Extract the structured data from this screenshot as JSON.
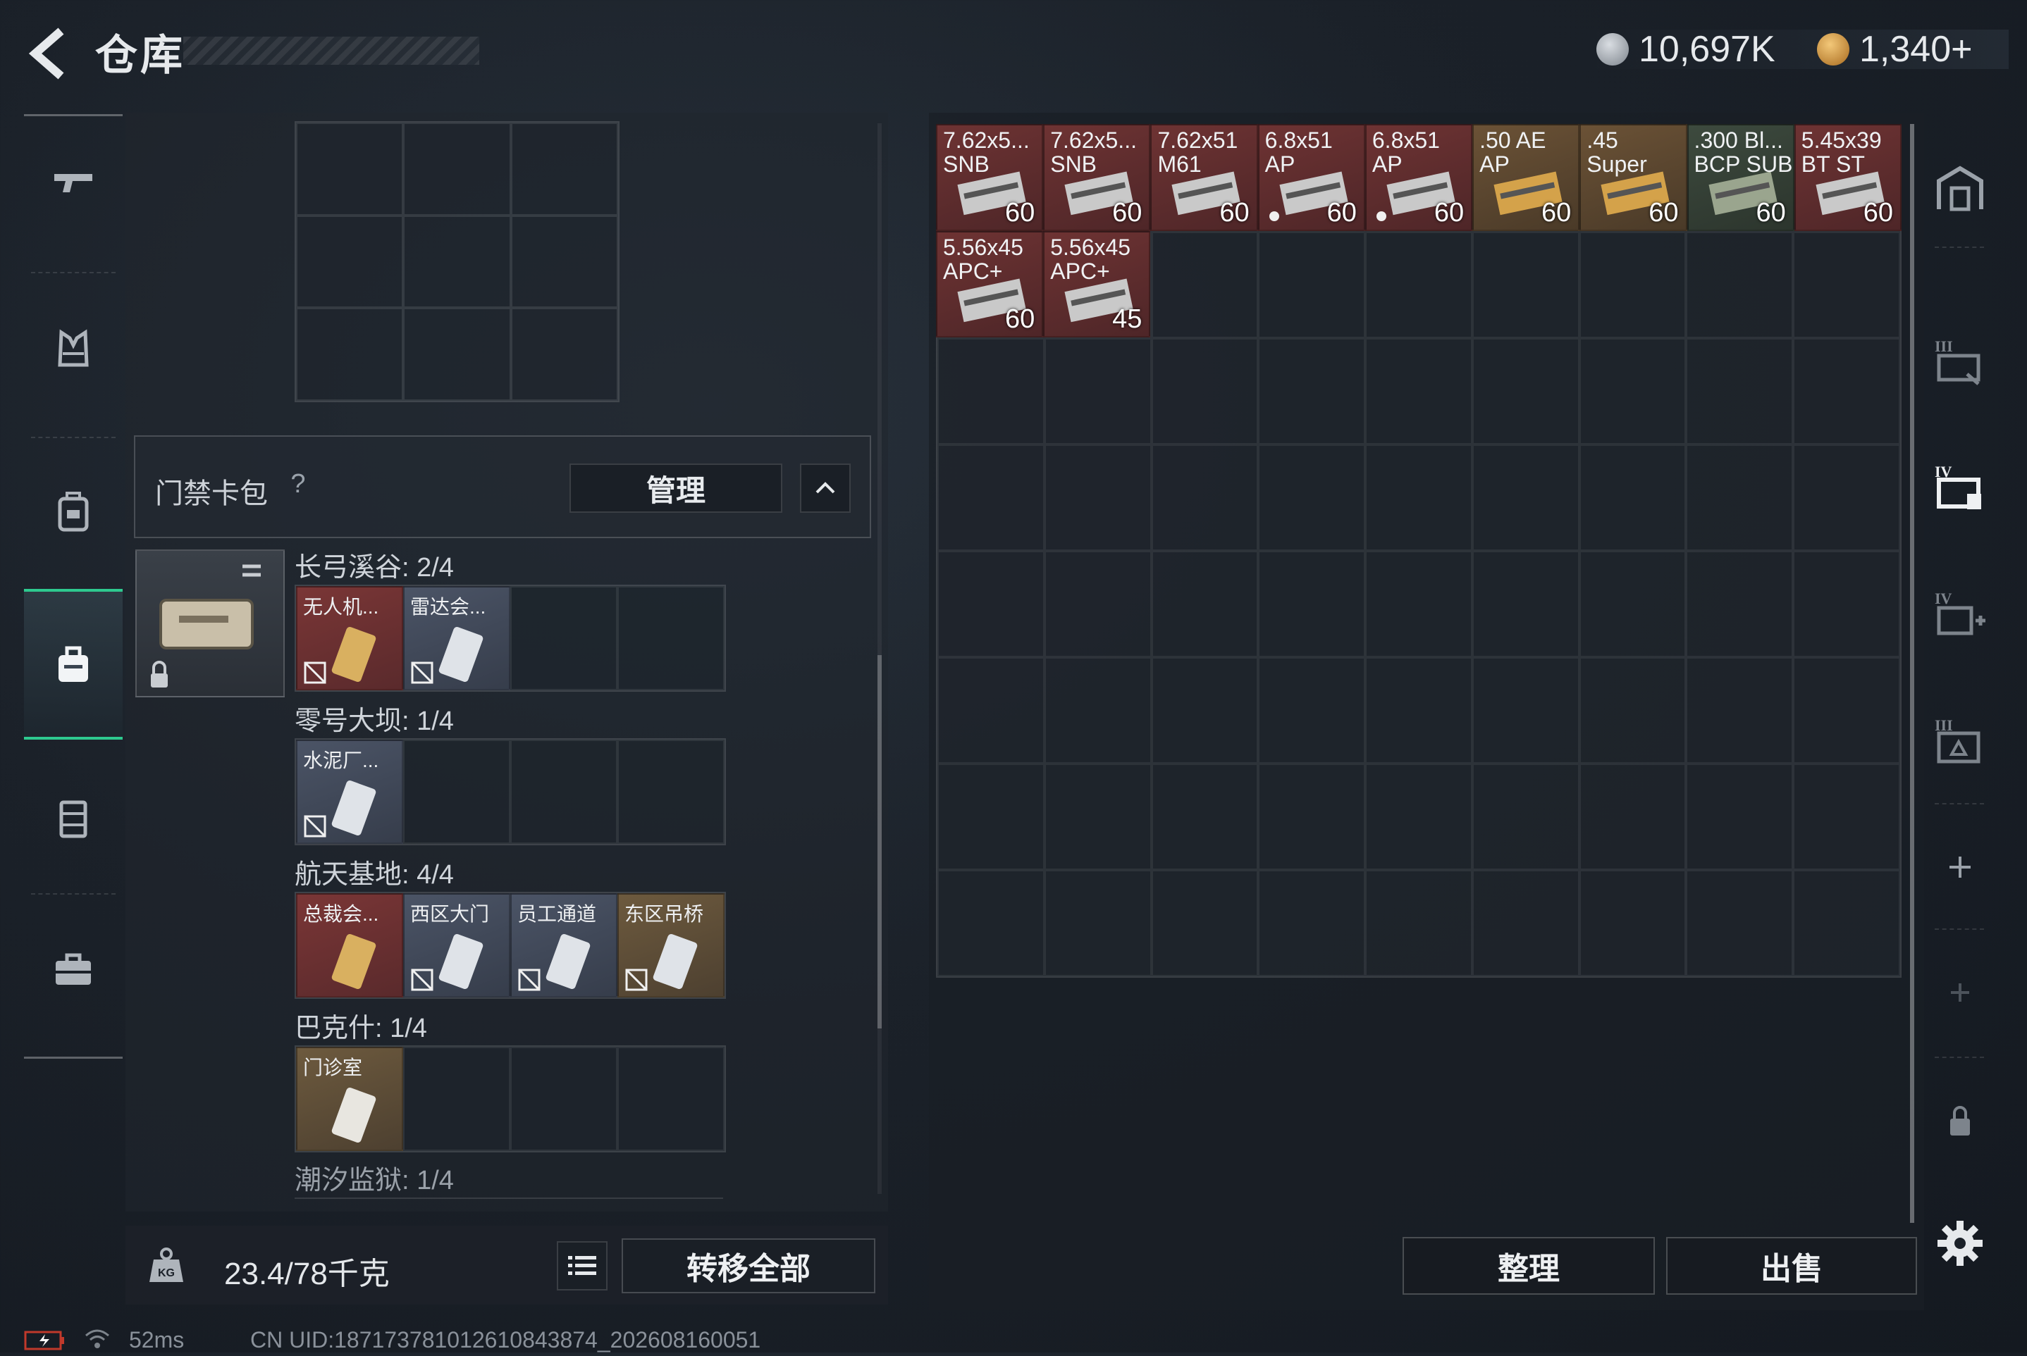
{
  "header": {
    "title": "仓库",
    "currency1": "10,697K",
    "currency2": "1,340+"
  },
  "card_pack": {
    "label": "门禁卡包",
    "help": "?",
    "manage": "管理"
  },
  "areas": [
    {
      "label": "长弓溪谷: 2/4",
      "cards": [
        {
          "name": "无人机...",
          "color": "red"
        },
        {
          "name": "雷达会...",
          "color": "blue"
        }
      ]
    },
    {
      "label": "零号大坝: 1/4",
      "cards": [
        {
          "name": "水泥厂...",
          "color": "blue"
        }
      ]
    },
    {
      "label": "航天基地: 4/4",
      "cards": [
        {
          "name": "总裁会...",
          "color": "red"
        },
        {
          "name": "西区大门",
          "color": "blue"
        },
        {
          "name": "员工通道",
          "color": "blue"
        },
        {
          "name": "东区吊桥",
          "color": "gold"
        }
      ]
    },
    {
      "label": "巴克什: 1/4",
      "cards": [
        {
          "name": "门诊室",
          "color": "gold"
        }
      ]
    },
    {
      "label": "潮汐监狱: 1/4",
      "cards": []
    }
  ],
  "weight": {
    "text": "23.4/78千克"
  },
  "buttons": {
    "transfer_all": "转移全部",
    "sort": "整理",
    "sell": "出售"
  },
  "ammo": [
    {
      "name1": "7.62x5...",
      "name2": "SNB",
      "count": "60",
      "color": "red"
    },
    {
      "name1": "7.62x5...",
      "name2": "SNB",
      "count": "60",
      "color": "red"
    },
    {
      "name1": "7.62x51",
      "name2": "M61",
      "count": "60",
      "color": "red"
    },
    {
      "name1": "6.8x51",
      "name2": "AP",
      "count": "60",
      "color": "red"
    },
    {
      "name1": "6.8x51",
      "name2": "AP",
      "count": "60",
      "color": "red"
    },
    {
      "name1": ".50 AE",
      "name2": "AP",
      "count": "60",
      "color": "gold"
    },
    {
      "name1": ".45",
      "name2": "Super",
      "count": "60",
      "color": "gold"
    },
    {
      "name1": ".300 Bl...",
      "name2": "BCP SUB",
      "count": "60",
      "color": "green"
    },
    {
      "name1": "5.45x39",
      "name2": "BT ST",
      "count": "60",
      "color": "red"
    },
    {
      "name1": "5.56x45",
      "name2": "APC+",
      "count": "60",
      "color": "red"
    },
    {
      "name1": "5.56x45",
      "name2": "APC+",
      "count": "45",
      "color": "red"
    }
  ],
  "status": {
    "ping": "52ms",
    "uid": "CN UID:18717378101261084387‌4_202608160051"
  },
  "colors": {
    "accent": "#2ec98f",
    "red_item": "#6e3333",
    "gold_item": "#6b5236",
    "blue_item": "#4b5466"
  }
}
